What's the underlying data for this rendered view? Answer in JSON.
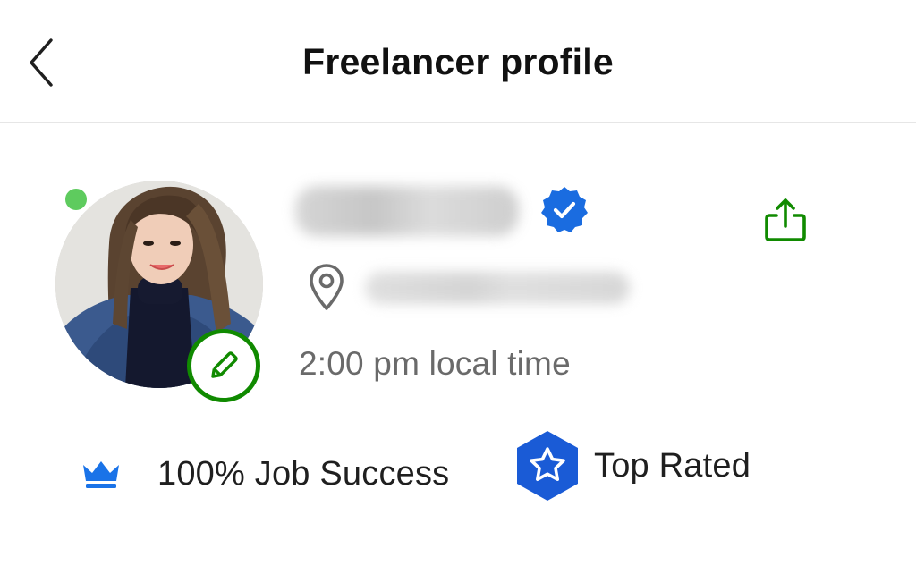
{
  "header": {
    "title": "Freelancer profile",
    "back_icon": "chevron-left-icon"
  },
  "profile": {
    "online_status_color": "#5ecb5e",
    "edit_icon": "pencil-icon",
    "verified_icon": "verified-badge-icon",
    "share_icon": "share-icon",
    "location_icon": "map-pin-icon",
    "local_time": "2:00 pm local time"
  },
  "badges": {
    "job_success": {
      "icon": "crown-icon",
      "label": "100% Job Success",
      "color": "#1a73e8"
    },
    "top_rated": {
      "icon": "top-rated-star-icon",
      "label": "Top Rated",
      "color": "#1a5bd6"
    }
  },
  "colors": {
    "brand_green": "#108a00",
    "verified_blue": "#1a6ce0",
    "text_secondary": "#6a6a6a"
  }
}
